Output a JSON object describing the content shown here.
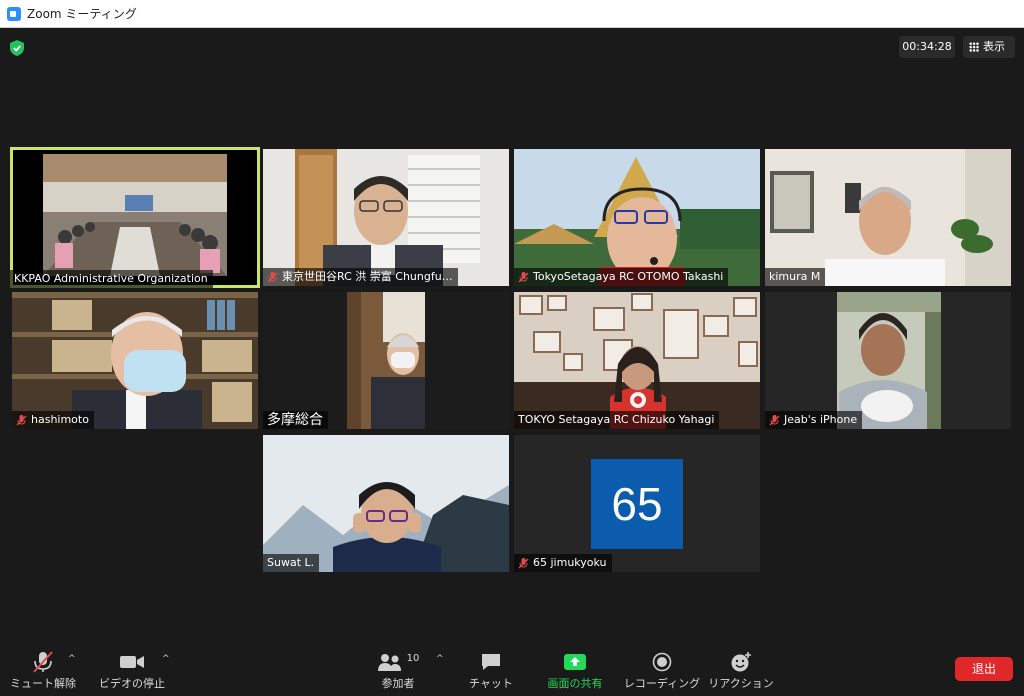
{
  "window": {
    "title": "Zoom ミーティング"
  },
  "top_bar": {
    "timer": "00:34:28",
    "view_label": "表示"
  },
  "participants": [
    {
      "name": "KKPAO Administrative Organization",
      "muted": false,
      "active_speaker": true
    },
    {
      "name": "東京世田谷RC 洪 崇富 Chungfu…",
      "muted": true
    },
    {
      "name": "TokyoSetagaya RC OTOMO Takashi",
      "muted": true
    },
    {
      "name": "kimura M",
      "muted": false
    },
    {
      "name": "hashimoto",
      "muted": true
    },
    {
      "name": "多摩総合",
      "muted": false
    },
    {
      "name": "TOKYO Setagaya RC Chizuko Yahagi",
      "muted": false
    },
    {
      "name": "Jeab's iPhone",
      "muted": true
    },
    {
      "name": "Suwat L.",
      "muted": false
    },
    {
      "name": "65 jimukyoku",
      "muted": true,
      "avatar_text": "65",
      "avatar_color": "#0b5cad"
    }
  ],
  "toolbar": {
    "unmute_label": "ミュート解除",
    "video_label": "ビデオの停止",
    "participants_label": "参加者",
    "participants_count": "10",
    "chat_label": "チャット",
    "share_label": "画面の共有",
    "record_label": "レコーディング",
    "reaction_label": "リアクション",
    "leave_label": "退出"
  },
  "colors": {
    "share_green": "#23d959",
    "leave_red": "#e02828",
    "active_border": "#c8e66b"
  }
}
